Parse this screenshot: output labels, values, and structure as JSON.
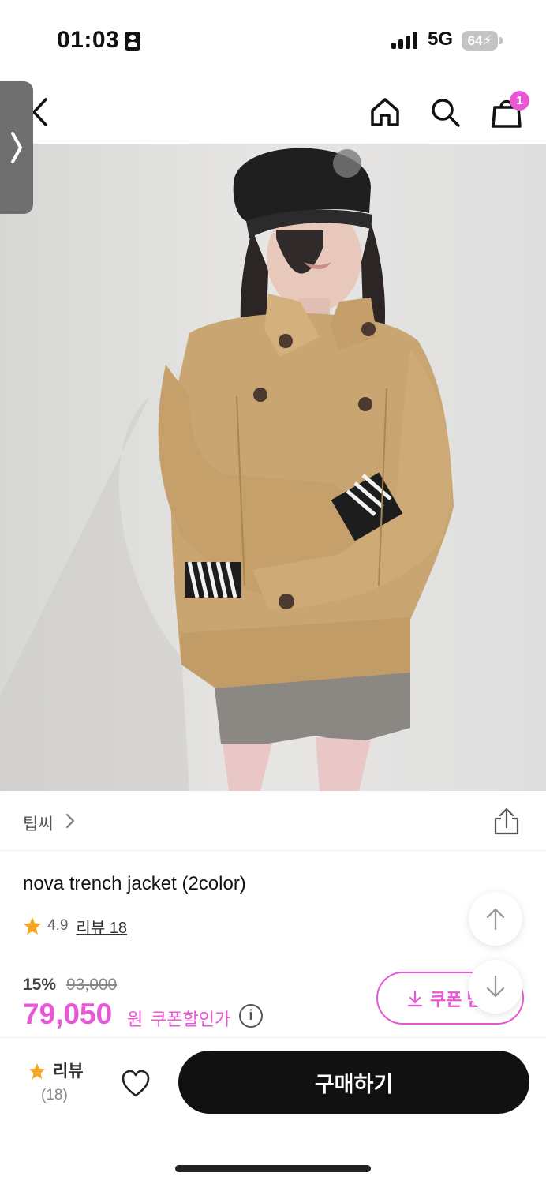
{
  "status_bar": {
    "time": "01:03",
    "network": "5G",
    "battery": "64"
  },
  "nav": {
    "cart_count": "1"
  },
  "product": {
    "brand": "팁씨",
    "title": "nova trench jacket (2color)",
    "rating": "4.9",
    "review_label": "리뷰 18",
    "discount_rate": "15%",
    "original_price": "93,000",
    "sale_price": "79,050",
    "price_unit": "원",
    "coupon_price_label": "쿠폰할인가",
    "coupon_button_label": "쿠폰 받"
  },
  "bottom_bar": {
    "review_label": "리뷰",
    "review_count": "(18)",
    "buy_label": "구매하기"
  },
  "colors": {
    "accent": "#e857d5",
    "buy_button": "#111111",
    "star": "#f5a623"
  }
}
